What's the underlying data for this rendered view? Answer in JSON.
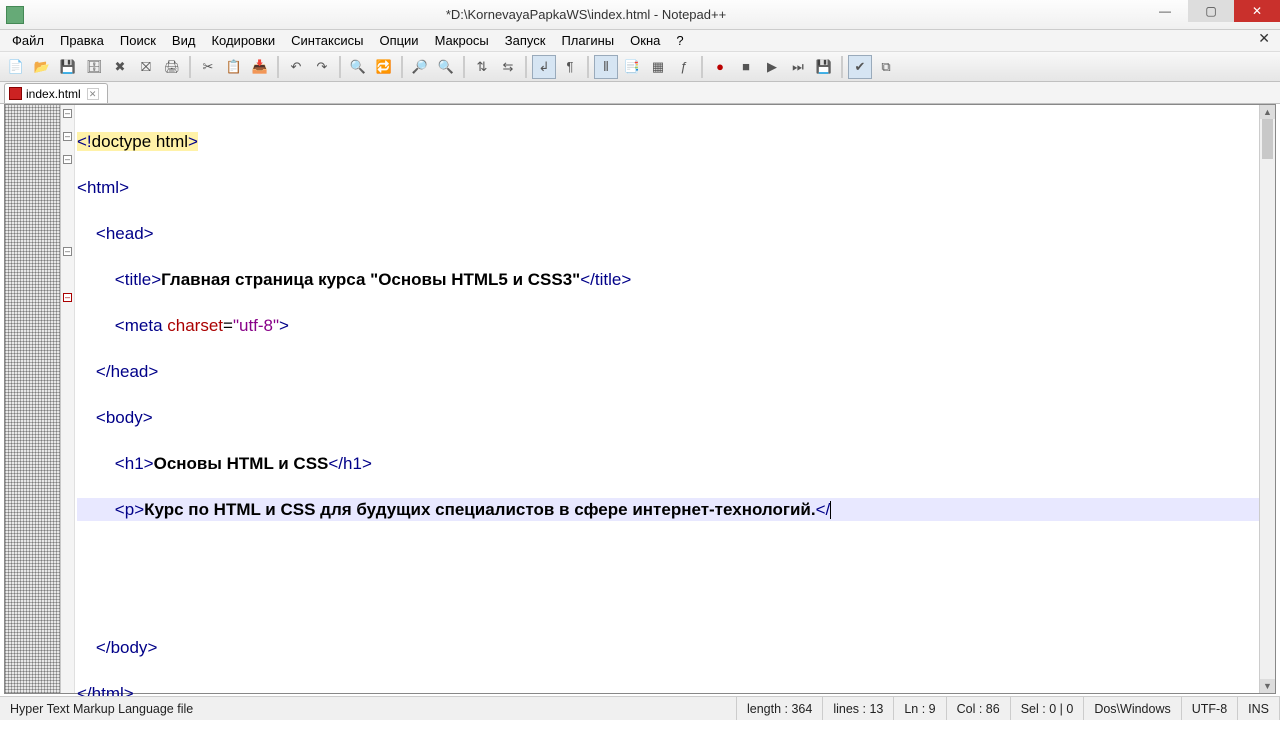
{
  "window": {
    "title": "*D:\\KornevayaPapkaWS\\index.html - Notepad++"
  },
  "menu": {
    "items": [
      "Файл",
      "Правка",
      "Поиск",
      "Вид",
      "Кодировки",
      "Синтаксисы",
      "Опции",
      "Макросы",
      "Запуск",
      "Плагины",
      "Окна",
      "?"
    ]
  },
  "tab": {
    "filename": "index.html"
  },
  "code": {
    "l1": {
      "open": "<!",
      "doctype": "doctype html",
      "close": ">"
    },
    "l2": {
      "open": "<",
      "tag": "html",
      "close": ">"
    },
    "l3": {
      "open": "<",
      "tag": "head",
      "close": ">"
    },
    "l4": {
      "open": "<",
      "tag": "title",
      "mid": ">",
      "text": "Главная страница курса \"Основы HTML5 и CSS3\"",
      "copen": "</",
      "ctag": "title",
      "cclose": ">"
    },
    "l5": {
      "open": "<",
      "tag": "meta",
      "sp": " ",
      "attr": "charset",
      "eq": "=",
      "val": "\"utf-8\"",
      "close": ">"
    },
    "l6": {
      "open": "</",
      "tag": "head",
      "close": ">"
    },
    "l7": {
      "open": "<",
      "tag": "body",
      "close": ">"
    },
    "l8": {
      "open": "<",
      "tag": "h1",
      "mid": ">",
      "text": "Основы HTML и CSS",
      "copen": "</",
      "ctag": "h1",
      "cclose": ">"
    },
    "l9": {
      "open": "<",
      "tag": "p",
      "mid": ">",
      "text": "Курс по HTML и CSS для будущих специалистов в сфере интернет-технологий.",
      "copen": "</"
    },
    "l11": {
      "open": "</",
      "tag": "body",
      "close": ">"
    },
    "l12": {
      "open": "</",
      "tag": "html",
      "close": ">"
    }
  },
  "status": {
    "filetype": "Hyper Text Markup Language file",
    "length": "length : 364",
    "lines": "lines : 13",
    "ln": "Ln : 9",
    "col": "Col : 86",
    "sel": "Sel : 0 | 0",
    "eol": "Dos\\Windows",
    "enc": "UTF-8",
    "mode": "INS"
  }
}
